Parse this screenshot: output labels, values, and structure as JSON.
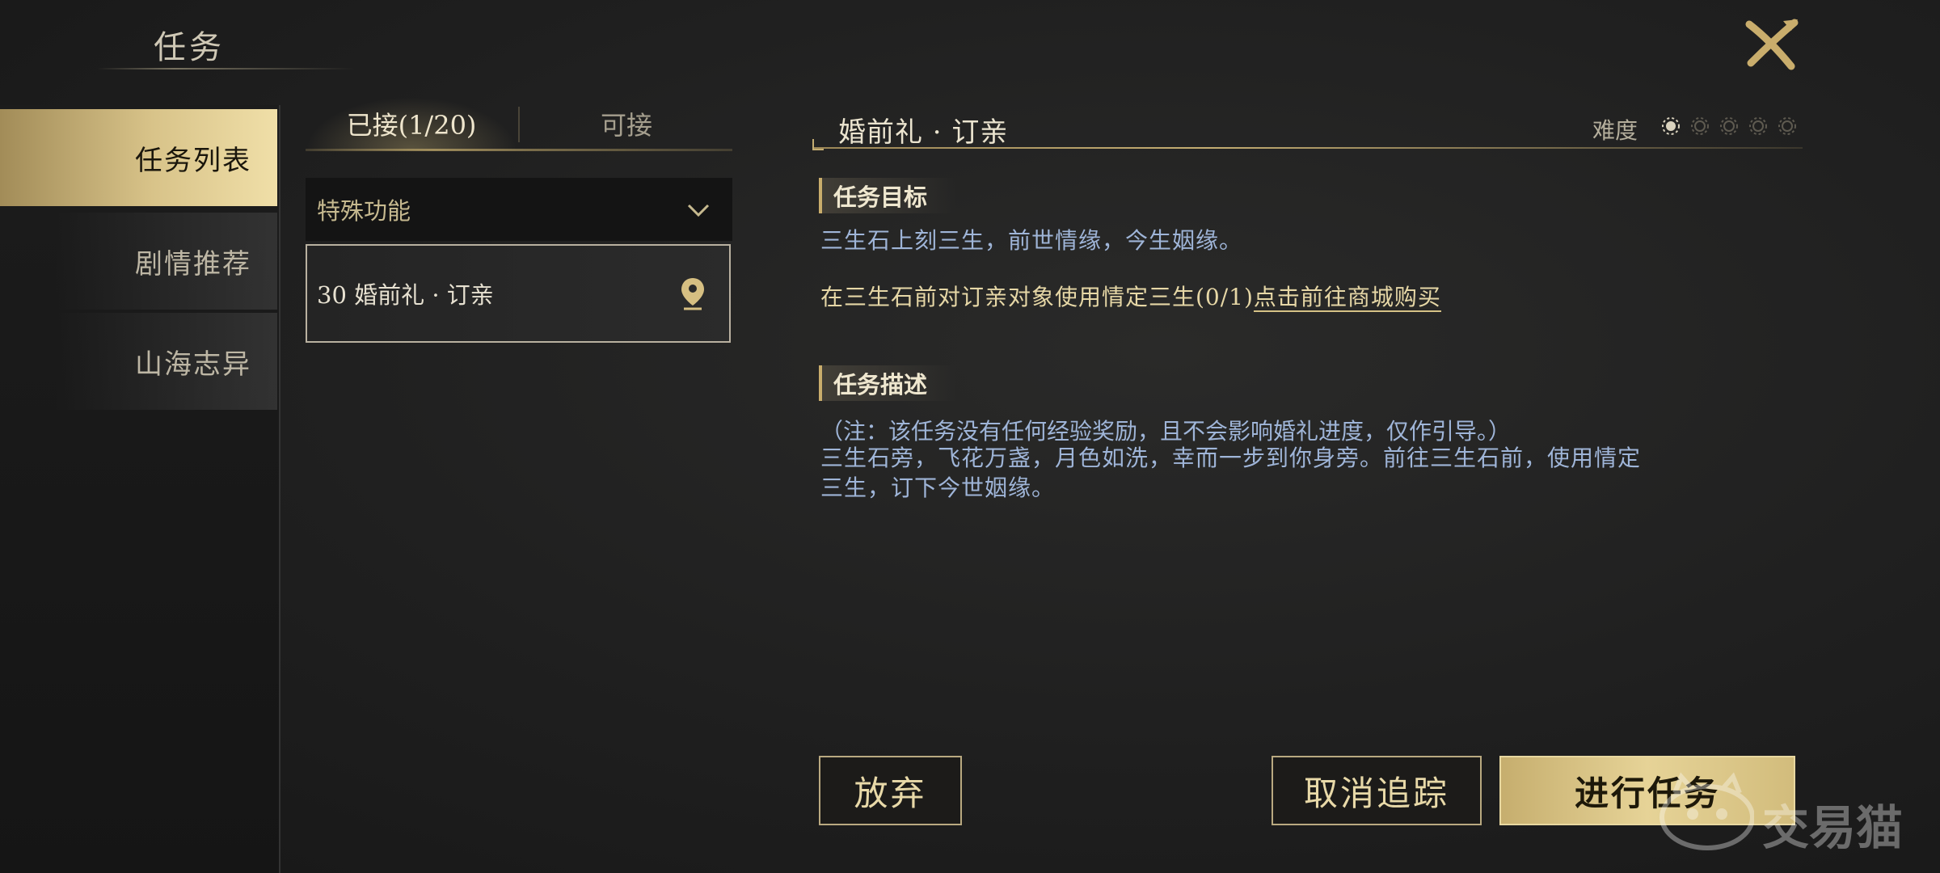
{
  "header": {
    "title": "任务"
  },
  "sidebar": {
    "items": [
      {
        "label": "任务列表",
        "active": true
      },
      {
        "label": "剧情推荐",
        "active": false
      },
      {
        "label": "山海志异",
        "active": false
      }
    ]
  },
  "quest_list": {
    "tabs": [
      {
        "label": "已接(1/20)",
        "active": true
      },
      {
        "label": "可接",
        "active": false
      }
    ],
    "category": "特殊功能",
    "items": [
      {
        "label": "30 婚前礼 · 订亲",
        "icon": "location-pin-icon"
      }
    ]
  },
  "detail": {
    "title": "婚前礼 · 订亲",
    "difficulty_label": "难度",
    "difficulty_level": 1,
    "difficulty_max": 5,
    "objective_heading": "任务目标",
    "objective_text": "三生石上刻三生，前世情缘，今生姻缘。",
    "objective_action": "在三生石前对订亲对象使用情定三生(0/1)",
    "objective_link": "点击前往商城购买",
    "description_heading": "任务描述",
    "description_note": "（注：该任务没有任何经验奖励，且不会影响婚礼进度，仅作引导。）",
    "description_body": "三生石旁，飞花万盏，月色如洗，幸而一步到你身旁。前往三生石前，使用情定三生，订下今世姻缘。"
  },
  "buttons": {
    "abandon": "放弃",
    "untrack": "取消追踪",
    "proceed": "进行任务"
  },
  "watermark": {
    "text": "交易猫"
  },
  "colors": {
    "gold_accent": "#d8c389",
    "text_blue": "#9fb5d8",
    "text_gold": "#e6d7a6",
    "background": "#1f1f1f"
  }
}
